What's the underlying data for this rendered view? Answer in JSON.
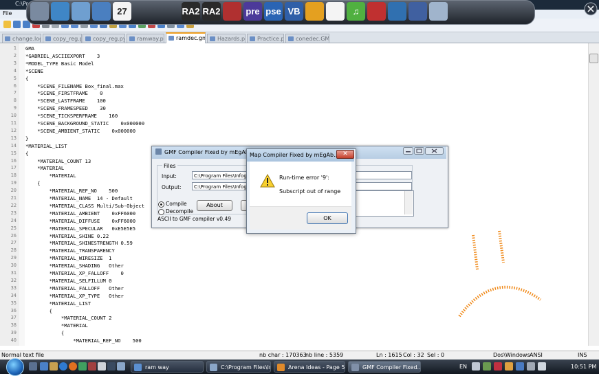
{
  "window": {
    "title": "C:\\Pro",
    "title_fragments": [
      "ogra",
      "Robot A ena",
      "Notep d++"
    ],
    "menu": {
      "file": "File"
    }
  },
  "dock": {
    "icons": [
      {
        "name": "folder-icon",
        "color": "#7a8aa0",
        "label": ""
      },
      {
        "name": "users-icon",
        "color": "#3f86c6",
        "label": ""
      },
      {
        "name": "mail-icon",
        "color": "#6f9fd0",
        "label": ""
      },
      {
        "name": "globe-icon",
        "color": "#4a7fc0",
        "label": ""
      },
      {
        "name": "calendar-icon",
        "color": "#f4f4f4",
        "label": "27"
      },
      {
        "name": "ra2-icon",
        "color": "#2a2a2a",
        "label": "RA2"
      },
      {
        "name": "ra2-yr-icon",
        "color": "#2a2a2a",
        "label": "RA2"
      },
      {
        "name": "books-icon",
        "color": "#b03030",
        "label": ""
      },
      {
        "name": "premiere-icon",
        "color": "#4c3a9a",
        "label": "pre"
      },
      {
        "name": "photoshop-elements-icon",
        "color": "#2a64b4",
        "label": "pse"
      },
      {
        "name": "visual-basic-icon",
        "color": "#2f5fa8",
        "label": "VB"
      },
      {
        "name": "audio-icon",
        "color": "#e4a020",
        "label": ""
      },
      {
        "name": "piano-icon",
        "color": "#f4f4f4",
        "label": ""
      },
      {
        "name": "music-icon",
        "color": "#50b040",
        "label": "♫"
      },
      {
        "name": "checklist-icon",
        "color": "#c03030",
        "label": ""
      },
      {
        "name": "settings-icon",
        "color": "#3070b0",
        "label": ""
      },
      {
        "name": "photo-icon",
        "color": "#4060a0",
        "label": ""
      },
      {
        "name": "computer-icon",
        "color": "#a0b4cc",
        "label": ""
      }
    ]
  },
  "tabs": [
    {
      "label": "change.log",
      "active": false
    },
    {
      "label": "copy_reg.pyc",
      "active": false
    },
    {
      "label": "copy_reg.py",
      "active": false
    },
    {
      "label": "ramway.py",
      "active": false
    },
    {
      "label": "ramdec.gmf",
      "active": true
    },
    {
      "label": "Hazards.py",
      "active": false
    },
    {
      "label": "Practice.py",
      "active": false
    },
    {
      "label": "conedec.GMF",
      "active": false
    }
  ],
  "editor": {
    "lines": [
      {
        "n": "1",
        "text": "GMA"
      },
      {
        "n": "2",
        "text": "*GABRIEL_ASCIIEXPORT    3"
      },
      {
        "n": "3",
        "text": "*MODEL_TYPE Basic Model"
      },
      {
        "n": "4",
        "text": "*SCENE"
      },
      {
        "n": "5",
        "text": "{"
      },
      {
        "n": "6",
        "text": "    *SCENE_FILENAME Box_final.max"
      },
      {
        "n": "7",
        "text": "    *SCENE_FIRSTFRAME    0"
      },
      {
        "n": "8",
        "text": "    *SCENE_LASTFRAME    100"
      },
      {
        "n": "9",
        "text": "    *SCENE_FRAMESPEED    30"
      },
      {
        "n": "10",
        "text": "    *SCENE_TICKSPERFRAME    160"
      },
      {
        "n": "11",
        "text": "    *SCENE_BACKGROUND_STATIC    0x000000"
      },
      {
        "n": "12",
        "text": "    *SCENE_AMBIENT_STATIC    0x000000"
      },
      {
        "n": "13",
        "text": "}"
      },
      {
        "n": "14",
        "text": "*MATERIAL_LIST"
      },
      {
        "n": "15",
        "text": "{"
      },
      {
        "n": "16",
        "text": "    *MATERIAL_COUNT 13"
      },
      {
        "n": "17",
        "text": "    *MATERIAL"
      },
      {
        "n": "18",
        "text": "        *MATERIAL"
      },
      {
        "n": "19",
        "text": "    {"
      },
      {
        "n": "20",
        "text": "        *MATERIAL_REF_NO    500"
      },
      {
        "n": "21",
        "text": "        *MATERIAL_NAME  14 - Default"
      },
      {
        "n": "22",
        "text": "        *MATERIAL_CLASS Multi/Sub-Object"
      },
      {
        "n": "23",
        "text": "        *MATERIAL_AMBIENT    0xFF6000"
      },
      {
        "n": "24",
        "text": "        *MATERIAL_DIFFUSE    0xFF6000"
      },
      {
        "n": "25",
        "text": "        *MATERIAL_SPECULAR   0xE5E5E5"
      },
      {
        "n": "26",
        "text": "        *MATERIAL_SHINE 0.22"
      },
      {
        "n": "27",
        "text": "        *MATERIAL_SHINESTRENGTH 0.59"
      },
      {
        "n": "28",
        "text": "        *MATERIAL_TRANSPARENCY"
      },
      {
        "n": "29",
        "text": "        *MATERIAL_WIRESIZE  1"
      },
      {
        "n": "30",
        "text": "        *MATERIAL_SHADING   Other"
      },
      {
        "n": "31",
        "text": "        *MATERIAL_XP_FALLOFF    0"
      },
      {
        "n": "32",
        "text": "        *MATERIAL_SELFILLUM 0"
      },
      {
        "n": "33",
        "text": "        *MATERIAL_FALLOFF   Other"
      },
      {
        "n": "34",
        "text": "        *MATERIAL_XP_TYPE   Other"
      },
      {
        "n": "35",
        "text": "        *MATERIAL_LIST"
      },
      {
        "n": "36",
        "text": "        {"
      },
      {
        "n": "37",
        "text": "            *MATERIAL_COUNT 2"
      },
      {
        "n": "38",
        "text": "            *MATERIAL"
      },
      {
        "n": "39",
        "text": "            {"
      },
      {
        "n": "40",
        "text": "                *MATERIAL_REF_NO    500"
      }
    ]
  },
  "status": {
    "file_type": "Normal text file",
    "nb_char": "nb char : 170363",
    "nb_line": "nb line : 5359",
    "ln": "Ln : 1615",
    "col": "Col : 32",
    "sel": "Sel : 0",
    "eol": "Dos\\Windows",
    "encoding": "ANSI",
    "mode": "INS"
  },
  "gmf_dialog": {
    "title": "GMF Compiler Fixed by mEgAbY",
    "files_label": "Files",
    "input_label": "Input:",
    "input_value": "C:\\Program Files\\Infogr",
    "output_label": "Output:",
    "output_value": "C:\\Program Files\\Infogr",
    "compile_label": "Compile",
    "decompile_label": "Decompile",
    "about_label": "About",
    "version": "ASCII to GMF compiler v0.49"
  },
  "error_dialog": {
    "title": "Map Compiler Fixed by mEgAb...",
    "line1": "Run-time error '9':",
    "line2": "Subscript out of range",
    "ok_label": "OK",
    "close_label": "✕"
  },
  "taskbar": {
    "tasks": [
      {
        "label": "ram way",
        "color": "#5b8fd0",
        "active": false
      },
      {
        "label": "C:\\Program Files\\Inf...",
        "color": "#8aa6c8",
        "active": false
      },
      {
        "label": "Arena Ideas - Page 5...",
        "color": "#e08a2a",
        "active": false
      },
      {
        "label": "GMF Compiler Fixed...",
        "color": "#8090a8",
        "active": true
      }
    ],
    "lang": "EN",
    "clock": "10:51 PM"
  }
}
